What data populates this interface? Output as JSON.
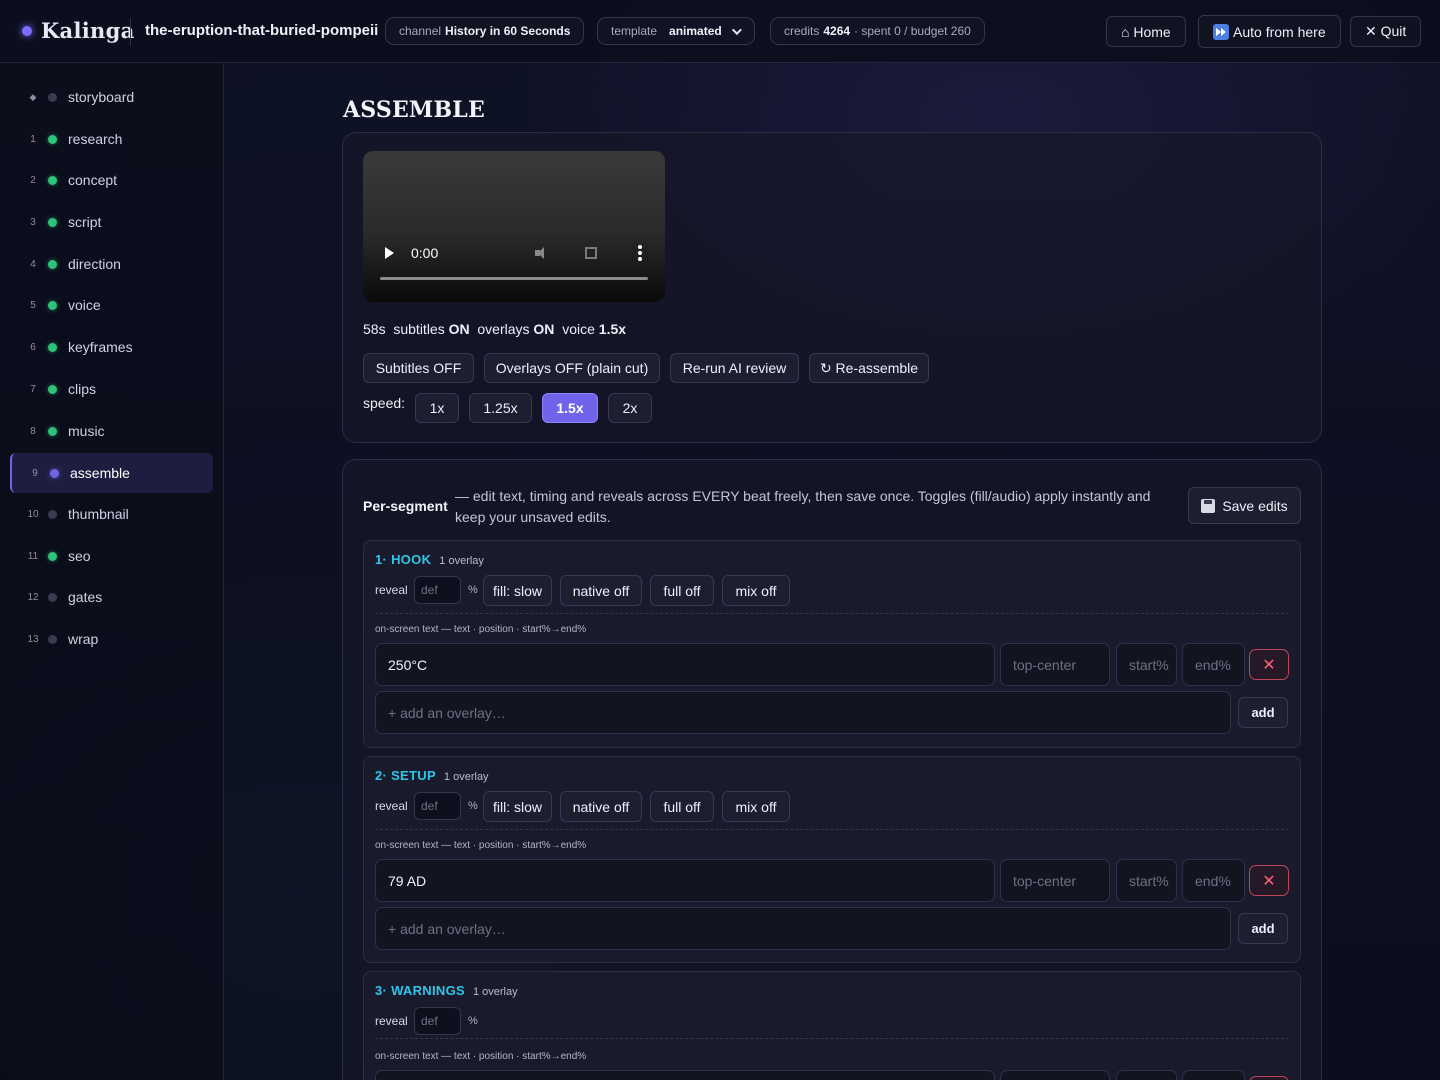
{
  "header": {
    "brand": "Kalinga",
    "project": "the-eruption-that-buried-pompeii",
    "channel_label": "channel",
    "channel_value": "History in 60 Seconds",
    "template_label": "template",
    "template_value": "animated",
    "credits_label": "credits",
    "credits_value": "4264",
    "credits_rest": "· spent 0 / budget 260",
    "home": "⌂ Home",
    "auto": "Auto from here",
    "quit": "✕ Quit"
  },
  "sidebar": {
    "items": [
      {
        "num": "◆",
        "label": "storyboard",
        "state": "todo"
      },
      {
        "num": "1",
        "label": "research",
        "state": "done"
      },
      {
        "num": "2",
        "label": "concept",
        "state": "done"
      },
      {
        "num": "3",
        "label": "script",
        "state": "done"
      },
      {
        "num": "4",
        "label": "direction",
        "state": "done"
      },
      {
        "num": "5",
        "label": "voice",
        "state": "done"
      },
      {
        "num": "6",
        "label": "keyframes",
        "state": "done"
      },
      {
        "num": "7",
        "label": "clips",
        "state": "done"
      },
      {
        "num": "8",
        "label": "music",
        "state": "done"
      },
      {
        "num": "9",
        "label": "assemble",
        "state": "cur"
      },
      {
        "num": "10",
        "label": "thumbnail",
        "state": "todo"
      },
      {
        "num": "11",
        "label": "seo",
        "state": "done"
      },
      {
        "num": "12",
        "label": "gates",
        "state": "todo"
      },
      {
        "num": "13",
        "label": "wrap",
        "state": "todo"
      }
    ]
  },
  "assemble": {
    "title": "ASSEMBLE",
    "video_time": "0:00",
    "stats": {
      "duration": "58s",
      "subtitles_label": "subtitles",
      "subtitles_value": "ON",
      "overlays_label": "overlays",
      "overlays_value": "ON",
      "voice_label": "voice",
      "voice_value": "1.5x"
    },
    "actions": [
      "Subtitles OFF",
      "Overlays OFF (plain cut)",
      "Re-run AI review",
      "↻ Re-assemble"
    ],
    "speed_label": "speed:",
    "speeds": [
      "1x",
      "1.25x",
      "1.5x",
      "2x"
    ],
    "speed_selected": "1.5x"
  },
  "per_segment": {
    "title": "Per-segment",
    "description": "— edit text, timing and reveals across EVERY beat freely, then save once. Toggles (fill/audio) apply instantly and keep your unsaved edits.",
    "save_label": "Save edits",
    "reveal_label": "reveal",
    "reveal_placeholder": "def",
    "pct": "%",
    "toggles": [
      "fill: slow",
      "native off",
      "full off",
      "mix off"
    ],
    "onscreen_hint": "on-screen text — text · position · start%→end%",
    "position_placeholder": "top-center",
    "start_placeholder": "start%",
    "end_placeholder": "end%",
    "add_placeholder": "+ add an overlay…",
    "add_label": "add",
    "segments": [
      {
        "name": "1· HOOK",
        "count": "1 overlay",
        "overlay_text": "250°C"
      },
      {
        "name": "2· SETUP",
        "count": "1 overlay",
        "overlay_text": "79 AD"
      },
      {
        "name": "3· WARNINGS",
        "count": "1 overlay",
        "overlay_text": ""
      }
    ]
  }
}
